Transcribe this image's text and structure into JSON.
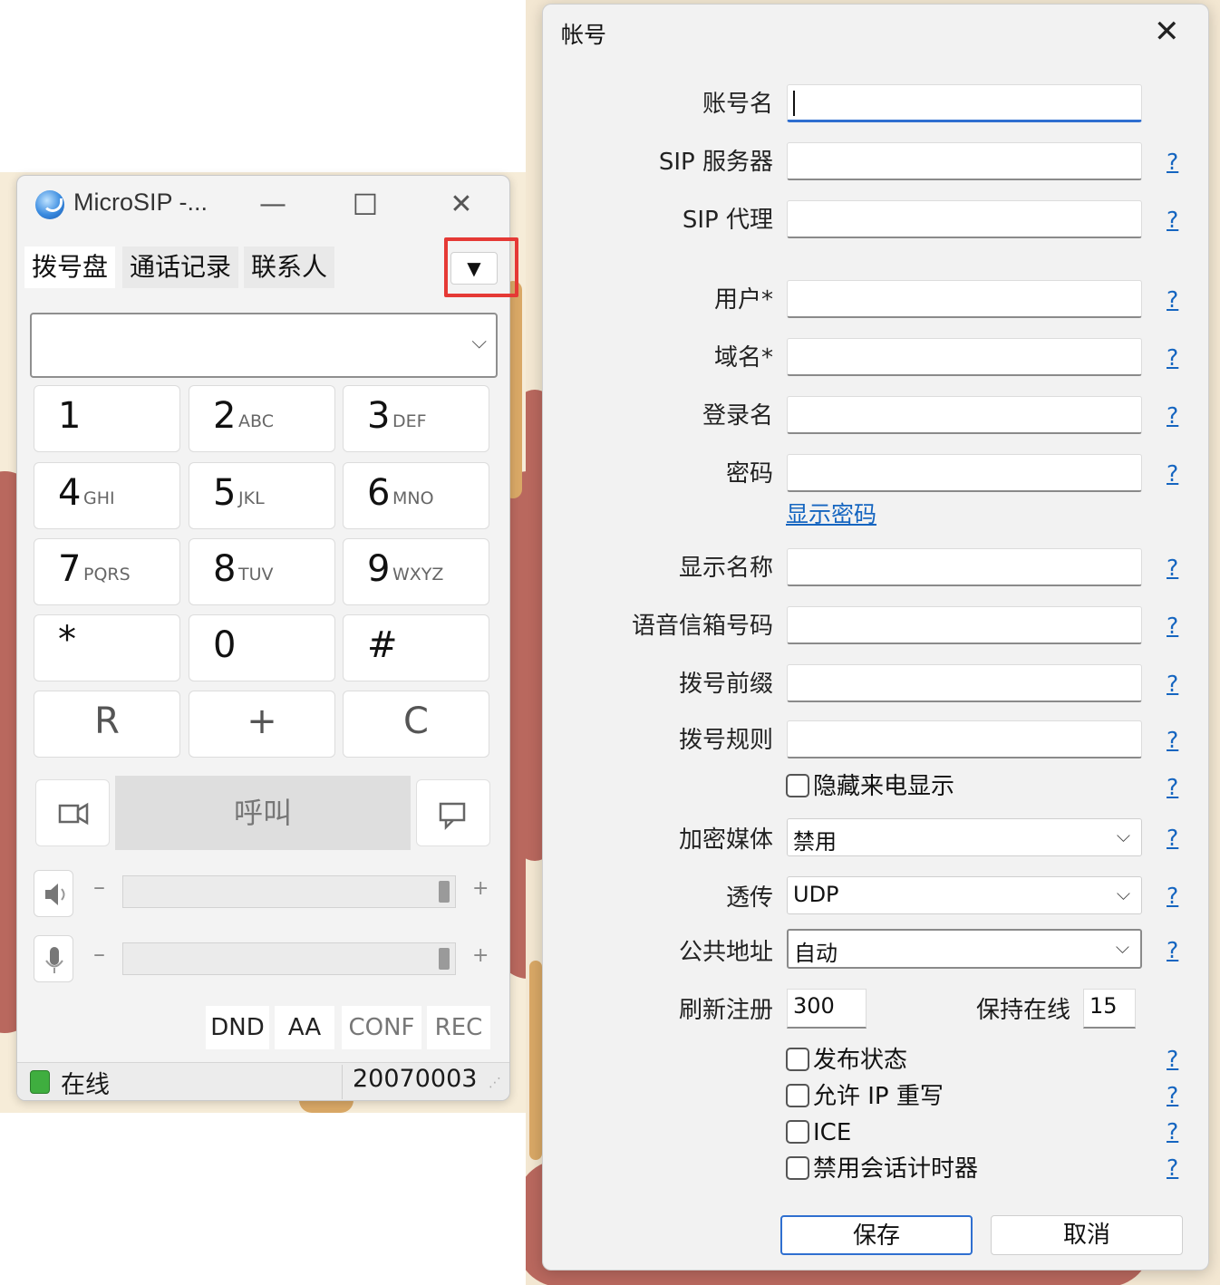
{
  "microsip": {
    "title": "MicroSIP -...",
    "window_controls": {
      "minimize": "—",
      "maximize": "☐",
      "close": "✕"
    },
    "tabs": [
      {
        "label": "拨号盘"
      },
      {
        "label": "通话记录"
      },
      {
        "label": "联系人"
      }
    ],
    "menu_button": "▼",
    "number_input_value": "",
    "keypad": [
      {
        "digit": "1",
        "letters": ""
      },
      {
        "digit": "2",
        "letters": "ABC"
      },
      {
        "digit": "3",
        "letters": "DEF"
      },
      {
        "digit": "4",
        "letters": "GHI"
      },
      {
        "digit": "5",
        "letters": "JKL"
      },
      {
        "digit": "6",
        "letters": "MNO"
      },
      {
        "digit": "7",
        "letters": "PQRS"
      },
      {
        "digit": "8",
        "letters": "TUV"
      },
      {
        "digit": "9",
        "letters": "WXYZ"
      },
      {
        "digit": "*",
        "letters": ""
      },
      {
        "digit": "0",
        "letters": ""
      },
      {
        "digit": "#",
        "letters": ""
      }
    ],
    "function_keys": [
      "R",
      "+",
      "C"
    ],
    "call_label": "呼叫",
    "volume_minus": "–",
    "volume_plus": "+",
    "speaker_level": 1.0,
    "mic_level": 1.0,
    "features": [
      "DND",
      "AA",
      "CONF",
      "REC"
    ],
    "status": {
      "text": "在线",
      "account": "20070003",
      "led_color": "#3fae3f"
    }
  },
  "account_dialog": {
    "title": "帐号",
    "close": "✕",
    "help": "?",
    "fields": {
      "account_name": {
        "label": "账号名",
        "value": ""
      },
      "sip_server": {
        "label": "SIP 服务器",
        "value": ""
      },
      "sip_proxy": {
        "label": "SIP 代理",
        "value": ""
      },
      "user": {
        "label": "用户*",
        "value": ""
      },
      "domain": {
        "label": "域名*",
        "value": ""
      },
      "login": {
        "label": "登录名",
        "value": ""
      },
      "password": {
        "label": "密码",
        "value": ""
      },
      "display_name": {
        "label": "显示名称",
        "value": ""
      },
      "voicemail": {
        "label": "语音信箱号码",
        "value": ""
      },
      "dial_prefix": {
        "label": "拨号前缀",
        "value": ""
      },
      "dial_plan": {
        "label": "拨号规则",
        "value": ""
      }
    },
    "show_password_link": "显示密码",
    "hide_caller_id": "隐藏来电显示",
    "selects": {
      "srtp": {
        "label": "加密媒体",
        "value": "禁用"
      },
      "transport": {
        "label": "透传",
        "value": "UDP"
      },
      "public_address": {
        "label": "公共地址",
        "value": "自动"
      }
    },
    "register_refresh": {
      "label": "刷新注册",
      "value": "300"
    },
    "keep_alive": {
      "label": "保持在线",
      "value": "15"
    },
    "checkboxes": {
      "publish_presence": "发布状态",
      "allow_ip_rewrite": "允许 IP 重写",
      "ice": "ICE",
      "disable_session_timers": "禁用会话计时器"
    },
    "buttons": {
      "save": "保存",
      "cancel": "取消"
    },
    "accent_color": "#2f6fd0",
    "link_color": "#1565c0"
  },
  "annotation": {
    "highlight_color": "#e53935"
  }
}
